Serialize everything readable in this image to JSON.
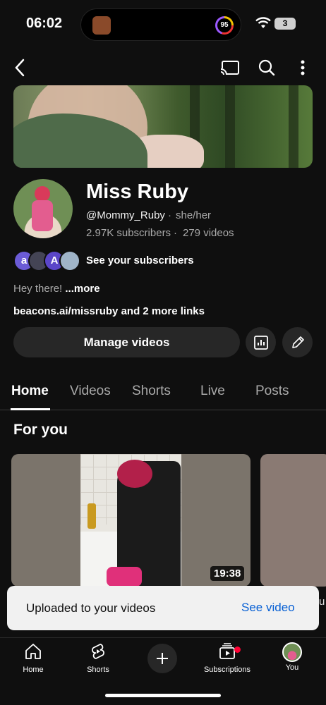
{
  "status_bar": {
    "time": "06:02",
    "activity_ring_value": "95",
    "battery": "3"
  },
  "channel": {
    "name": "Miss Ruby",
    "handle": "@Mommy_Ruby",
    "separator": "·",
    "pronouns": "she/her",
    "subscribers": "2.97K subscribers",
    "videos": "279 videos",
    "see_subscribers": "See your subscribers",
    "subscriber_avatars": [
      "a",
      "",
      "A",
      ""
    ],
    "description": "Hey there!",
    "description_more": "...more",
    "links": "beacons.ai/missruby and 2 more links",
    "manage_videos": "Manage videos"
  },
  "tabs": [
    "Home",
    "Videos",
    "Shorts",
    "Live",
    "Posts"
  ],
  "section_title": "For you",
  "video": {
    "duration": "19:38"
  },
  "snackbar": {
    "message": "Uploaded to your videos",
    "action": "See video",
    "peek_text": "u"
  },
  "bottom_nav": {
    "home": "Home",
    "shorts": "Shorts",
    "subscriptions": "Subscriptions",
    "you": "You"
  },
  "colors": {
    "background": "#0f0f0f",
    "snackbar_action": "#065fd4",
    "notification": "#ff0033"
  }
}
